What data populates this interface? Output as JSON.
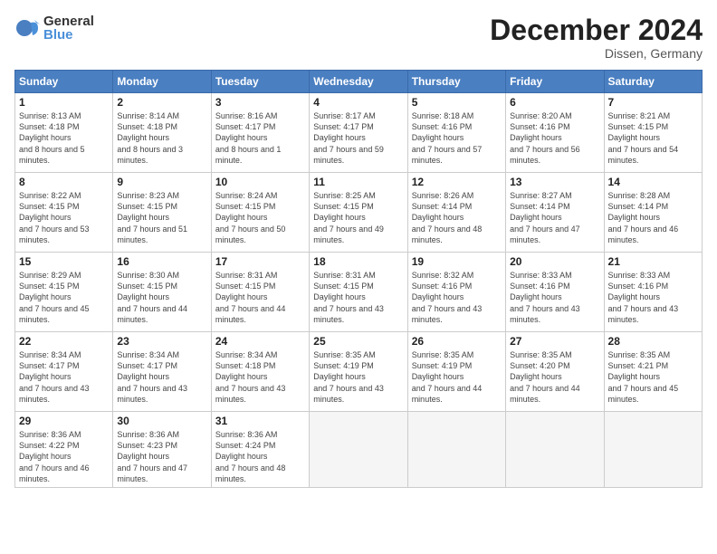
{
  "logo": {
    "general": "General",
    "blue": "Blue"
  },
  "title": "December 2024",
  "location": "Dissen, Germany",
  "days_header": [
    "Sunday",
    "Monday",
    "Tuesday",
    "Wednesday",
    "Thursday",
    "Friday",
    "Saturday"
  ],
  "weeks": [
    [
      {
        "day": "1",
        "sunrise": "8:13 AM",
        "sunset": "4:18 PM",
        "daylight": "8 hours and 5 minutes."
      },
      {
        "day": "2",
        "sunrise": "8:14 AM",
        "sunset": "4:18 PM",
        "daylight": "8 hours and 3 minutes."
      },
      {
        "day": "3",
        "sunrise": "8:16 AM",
        "sunset": "4:17 PM",
        "daylight": "8 hours and 1 minute."
      },
      {
        "day": "4",
        "sunrise": "8:17 AM",
        "sunset": "4:17 PM",
        "daylight": "7 hours and 59 minutes."
      },
      {
        "day": "5",
        "sunrise": "8:18 AM",
        "sunset": "4:16 PM",
        "daylight": "7 hours and 57 minutes."
      },
      {
        "day": "6",
        "sunrise": "8:20 AM",
        "sunset": "4:16 PM",
        "daylight": "7 hours and 56 minutes."
      },
      {
        "day": "7",
        "sunrise": "8:21 AM",
        "sunset": "4:15 PM",
        "daylight": "7 hours and 54 minutes."
      }
    ],
    [
      {
        "day": "8",
        "sunrise": "8:22 AM",
        "sunset": "4:15 PM",
        "daylight": "7 hours and 53 minutes."
      },
      {
        "day": "9",
        "sunrise": "8:23 AM",
        "sunset": "4:15 PM",
        "daylight": "7 hours and 51 minutes."
      },
      {
        "day": "10",
        "sunrise": "8:24 AM",
        "sunset": "4:15 PM",
        "daylight": "7 hours and 50 minutes."
      },
      {
        "day": "11",
        "sunrise": "8:25 AM",
        "sunset": "4:15 PM",
        "daylight": "7 hours and 49 minutes."
      },
      {
        "day": "12",
        "sunrise": "8:26 AM",
        "sunset": "4:14 PM",
        "daylight": "7 hours and 48 minutes."
      },
      {
        "day": "13",
        "sunrise": "8:27 AM",
        "sunset": "4:14 PM",
        "daylight": "7 hours and 47 minutes."
      },
      {
        "day": "14",
        "sunrise": "8:28 AM",
        "sunset": "4:14 PM",
        "daylight": "7 hours and 46 minutes."
      }
    ],
    [
      {
        "day": "15",
        "sunrise": "8:29 AM",
        "sunset": "4:15 PM",
        "daylight": "7 hours and 45 minutes."
      },
      {
        "day": "16",
        "sunrise": "8:30 AM",
        "sunset": "4:15 PM",
        "daylight": "7 hours and 44 minutes."
      },
      {
        "day": "17",
        "sunrise": "8:31 AM",
        "sunset": "4:15 PM",
        "daylight": "7 hours and 44 minutes."
      },
      {
        "day": "18",
        "sunrise": "8:31 AM",
        "sunset": "4:15 PM",
        "daylight": "7 hours and 43 minutes."
      },
      {
        "day": "19",
        "sunrise": "8:32 AM",
        "sunset": "4:16 PM",
        "daylight": "7 hours and 43 minutes."
      },
      {
        "day": "20",
        "sunrise": "8:33 AM",
        "sunset": "4:16 PM",
        "daylight": "7 hours and 43 minutes."
      },
      {
        "day": "21",
        "sunrise": "8:33 AM",
        "sunset": "4:16 PM",
        "daylight": "7 hours and 43 minutes."
      }
    ],
    [
      {
        "day": "22",
        "sunrise": "8:34 AM",
        "sunset": "4:17 PM",
        "daylight": "7 hours and 43 minutes."
      },
      {
        "day": "23",
        "sunrise": "8:34 AM",
        "sunset": "4:17 PM",
        "daylight": "7 hours and 43 minutes."
      },
      {
        "day": "24",
        "sunrise": "8:34 AM",
        "sunset": "4:18 PM",
        "daylight": "7 hours and 43 minutes."
      },
      {
        "day": "25",
        "sunrise": "8:35 AM",
        "sunset": "4:19 PM",
        "daylight": "7 hours and 43 minutes."
      },
      {
        "day": "26",
        "sunrise": "8:35 AM",
        "sunset": "4:19 PM",
        "daylight": "7 hours and 44 minutes."
      },
      {
        "day": "27",
        "sunrise": "8:35 AM",
        "sunset": "4:20 PM",
        "daylight": "7 hours and 44 minutes."
      },
      {
        "day": "28",
        "sunrise": "8:35 AM",
        "sunset": "4:21 PM",
        "daylight": "7 hours and 45 minutes."
      }
    ],
    [
      {
        "day": "29",
        "sunrise": "8:36 AM",
        "sunset": "4:22 PM",
        "daylight": "7 hours and 46 minutes."
      },
      {
        "day": "30",
        "sunrise": "8:36 AM",
        "sunset": "4:23 PM",
        "daylight": "7 hours and 47 minutes."
      },
      {
        "day": "31",
        "sunrise": "8:36 AM",
        "sunset": "4:24 PM",
        "daylight": "7 hours and 48 minutes."
      },
      null,
      null,
      null,
      null
    ]
  ]
}
